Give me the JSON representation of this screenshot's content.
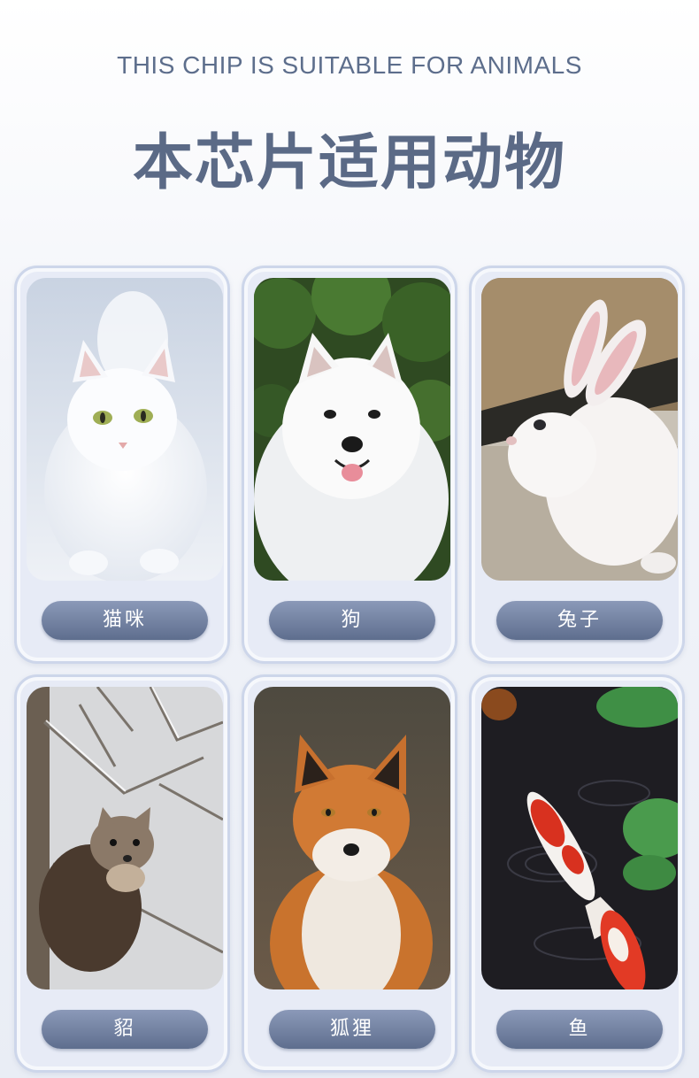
{
  "header": {
    "subtitle": "THIS CHIP IS SUITABLE FOR ANIMALS",
    "title": "本芯片适用动物"
  },
  "animals": [
    {
      "label": "猫咪",
      "photo": "white-cat-photo"
    },
    {
      "label": "狗",
      "photo": "samoyed-dog-photo"
    },
    {
      "label": "兔子",
      "photo": "white-rabbit-photo"
    },
    {
      "label": "貂",
      "photo": "marten-photo"
    },
    {
      "label": "狐狸",
      "photo": "red-fox-photo"
    },
    {
      "label": "鱼",
      "photo": "koi-fish-photo"
    }
  ]
}
